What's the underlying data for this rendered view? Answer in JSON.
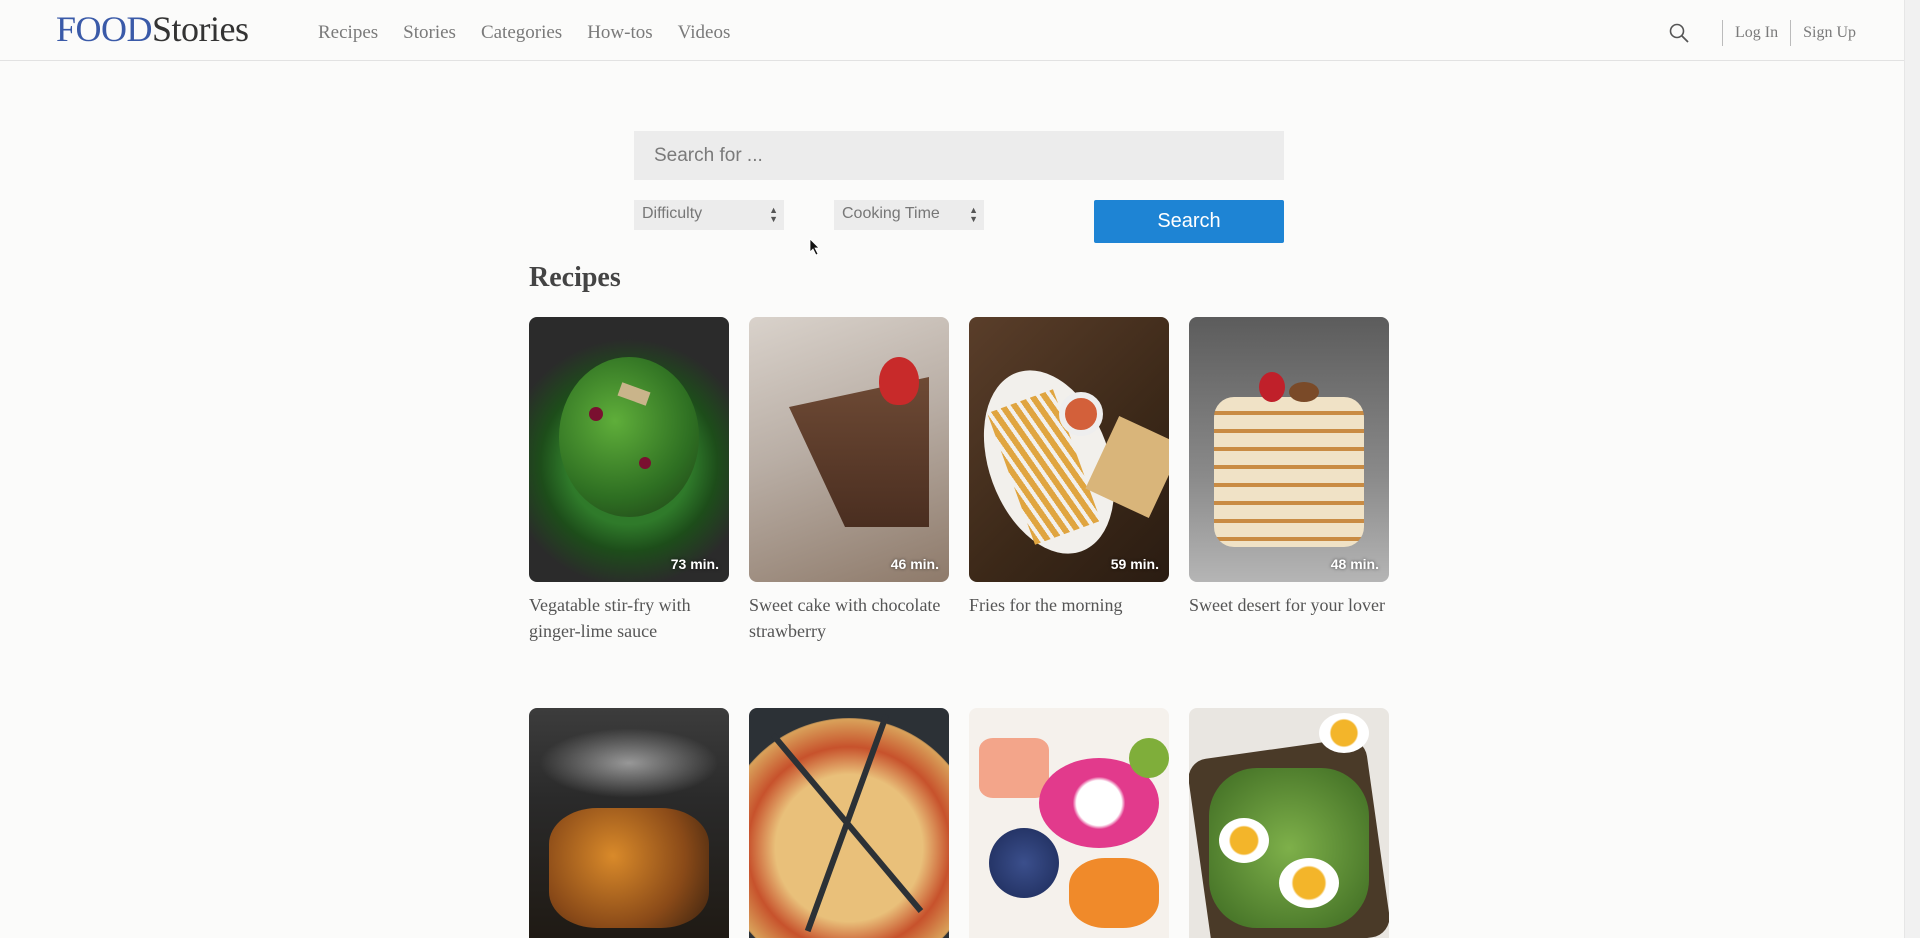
{
  "header": {
    "logo_food": "FOOD",
    "logo_stories": "Stories",
    "nav": [
      "Recipes",
      "Stories",
      "Categories",
      "How-tos",
      "Videos"
    ],
    "login": "Log In",
    "signup": "Sign Up"
  },
  "search": {
    "placeholder": "Search for ...",
    "difficulty": "Difficulty",
    "cooking_time": "Cooking Time",
    "button": "Search"
  },
  "recipes": {
    "heading": "Recipes",
    "row1": [
      {
        "title": "Vegatable stir-fry with ginger-lime sauce",
        "time": "73 min."
      },
      {
        "title": "Sweet cake with chocolate strawberry",
        "time": "46 min."
      },
      {
        "title": "Fries for the morning",
        "time": "59 min."
      },
      {
        "title": "Sweet desert for your lover",
        "time": "48 min."
      }
    ]
  },
  "colors": {
    "brand_blue": "#3a5aa8",
    "button_blue": "#1e84d4"
  }
}
